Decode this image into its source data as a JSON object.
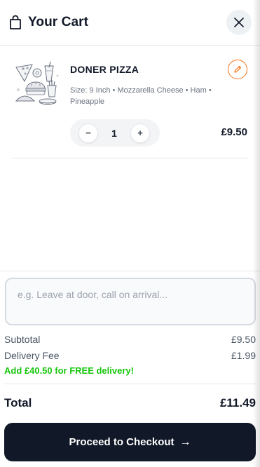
{
  "header": {
    "title": "Your Cart"
  },
  "item": {
    "name": "DONER PIZZA",
    "options": "Size: 9 Inch • Mozzarella Cheese • Ham • Pineapple",
    "quantity": "1",
    "price": "£9.50",
    "minus": "−",
    "plus": "+"
  },
  "notes": {
    "placeholder": "e.g. Leave at door, call on arrival..."
  },
  "summary": {
    "subtotal_label": "Subtotal",
    "subtotal_value": "£9.50",
    "delivery_label": "Delivery Fee",
    "delivery_value": "£1.99",
    "free_delivery_msg": "Add £40.50 for FREE delivery!",
    "total_label": "Total",
    "total_value": "£11.49"
  },
  "checkout": {
    "label": "Proceed to Checkout",
    "arrow": "→"
  },
  "colors": {
    "accent": "#f97316",
    "free_delivery": "#16c60c",
    "button_dark": "#111827"
  },
  "icons": [
    "shopping-bag-icon",
    "close-icon",
    "food-illustration",
    "pencil-icon",
    "arrow-right-icon"
  ]
}
